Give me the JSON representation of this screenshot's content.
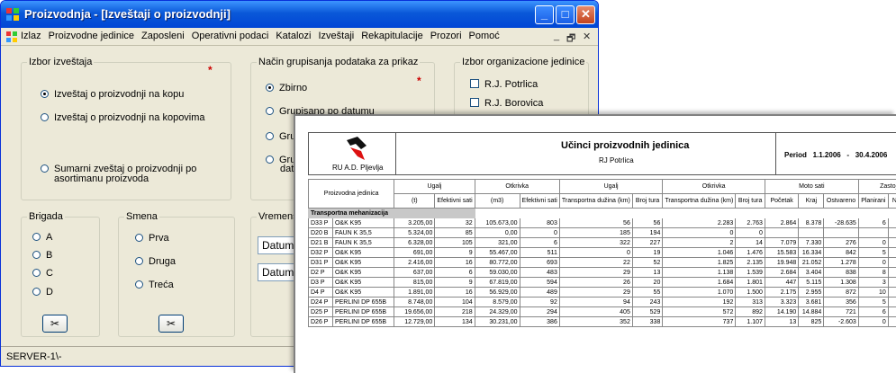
{
  "window": {
    "title": "Proizvodnja - [Izveštaji o proizvodnji]",
    "controls": {
      "minimize": "_",
      "maximize": "□",
      "close": "✕"
    }
  },
  "menu": {
    "items": [
      "Izlaz",
      "Proizvodne jedinice",
      "Zaposleni",
      "Operativni podaci",
      "Katalozi",
      "Izveštaji",
      "Rekapitulacije",
      "Prozori",
      "Pomoć"
    ],
    "mdi_controls": {
      "minimize": "_",
      "restore": "🗗",
      "close": "✕"
    }
  },
  "izbor_izvestaja": {
    "legend": "Izbor izveštaja",
    "star": "*",
    "options": [
      "Izveštaj o proizvodnji na kopu",
      "Izveštaj o proizvodnji na kopovima",
      "Sumarni zveštaj o proizvodnji po",
      "asortimanu proizvoda"
    ],
    "selected_index": 0
  },
  "grupisanje": {
    "legend": "Način grupisanja podataka za prikaz",
    "star": "*",
    "options": [
      "Zbirno",
      "Grupisano po datumu",
      "Gru",
      "Gru",
      "dat"
    ]
  },
  "org_jedinica": {
    "legend": "Izbor organizacione jedinice",
    "options": [
      "R.J. Potrlica",
      "R.J. Borovica"
    ]
  },
  "brigada": {
    "legend": "Brigada",
    "options": [
      "A",
      "B",
      "C",
      "D"
    ],
    "button": "✂"
  },
  "smena": {
    "legend": "Smena",
    "options": [
      "Prva",
      "Druga",
      "Treća"
    ],
    "button": "✂"
  },
  "vremenski": {
    "legend": "Vremens",
    "fields": [
      "Datum",
      "Datum"
    ]
  },
  "status": {
    "text": "SERVER-1\\-"
  },
  "report": {
    "company": "RU A.D. Pljevlja",
    "title": "Učinci proizvodnih jedinica",
    "subtitle": "RJ Potrlica",
    "period_label": "Period",
    "period_from": "1.1.2006",
    "period_sep": "-",
    "period_to": "30.4.2006",
    "headers_top": [
      "Proizvodna jedinica",
      "Ugalj",
      "Otkrivka",
      "Ugalj",
      "Otkrivka",
      "Moto sati",
      "Zastoji"
    ],
    "headers_sub": [
      "(t)",
      "Efektivni sati",
      "(m3)",
      "Efektivni sati",
      "Transportna dužina (km)",
      "Broj tura",
      "Transportna dužina (km)",
      "Broj tura",
      "Početak",
      "Kraj",
      "Ostvareno",
      "Planirani",
      "Neplanir"
    ],
    "section": "Transportna mehanizacija",
    "rows": [
      [
        "D33 P",
        "O&K K95",
        "3.205,00",
        "32",
        "105.673,00",
        "803",
        "56",
        "56",
        "2.283",
        "2.763",
        "2.864",
        "8.378",
        "-28.635",
        "6",
        ""
      ],
      [
        "D20 B",
        "FAUN K 35,5",
        "5.324,00",
        "85",
        "0,00",
        "0",
        "185",
        "194",
        "0",
        "0",
        "",
        "",
        "",
        "",
        ""
      ],
      [
        "D21 B",
        "FAUN K 35,5",
        "6.328,00",
        "105",
        "321,00",
        "6",
        "322",
        "227",
        "2",
        "14",
        "7.079",
        "7.330",
        "276",
        "0",
        ""
      ],
      [
        "D32 P",
        "O&K K95",
        "691,00",
        "9",
        "55.467,00",
        "511",
        "0",
        "19",
        "1.046",
        "1.476",
        "15.583",
        "16.334",
        "842",
        "5",
        ""
      ],
      [
        "D31 P",
        "O&K K95",
        "2.416,00",
        "16",
        "80.772,00",
        "693",
        "22",
        "52",
        "1.825",
        "2.135",
        "19.948",
        "21.052",
        "1.278",
        "0",
        ""
      ],
      [
        "D2 P",
        "O&K K95",
        "637,00",
        "6",
        "59.030,00",
        "483",
        "29",
        "13",
        "1.138",
        "1.539",
        "2.684",
        "3.404",
        "838",
        "8",
        ""
      ],
      [
        "D3 P",
        "O&K K95",
        "815,00",
        "9",
        "67.819,00",
        "594",
        "26",
        "20",
        "1.684",
        "1.801",
        "447",
        "5.115",
        "1.308",
        "3",
        ""
      ],
      [
        "D4 P",
        "O&K K95",
        "1.891,00",
        "16",
        "56.929,00",
        "489",
        "29",
        "55",
        "1.070",
        "1.500",
        "2.175",
        "2.955",
        "872",
        "10",
        ""
      ],
      [
        "D24 P",
        "PERLINI DP 655B",
        "8.748,00",
        "104",
        "8.579,00",
        "92",
        "94",
        "243",
        "192",
        "313",
        "3.323",
        "3.681",
        "356",
        "5",
        ""
      ],
      [
        "D25 P",
        "PERLINI DP 655B",
        "19.656,00",
        "218",
        "24.329,00",
        "294",
        "405",
        "529",
        "572",
        "892",
        "14.190",
        "14.884",
        "721",
        "6",
        ""
      ],
      [
        "D26 P",
        "PERLINI DP 655B",
        "12.729,00",
        "134",
        "30.231,00",
        "386",
        "352",
        "338",
        "737",
        "1.107",
        "13",
        "825",
        "-2.603",
        "0",
        ""
      ]
    ]
  }
}
